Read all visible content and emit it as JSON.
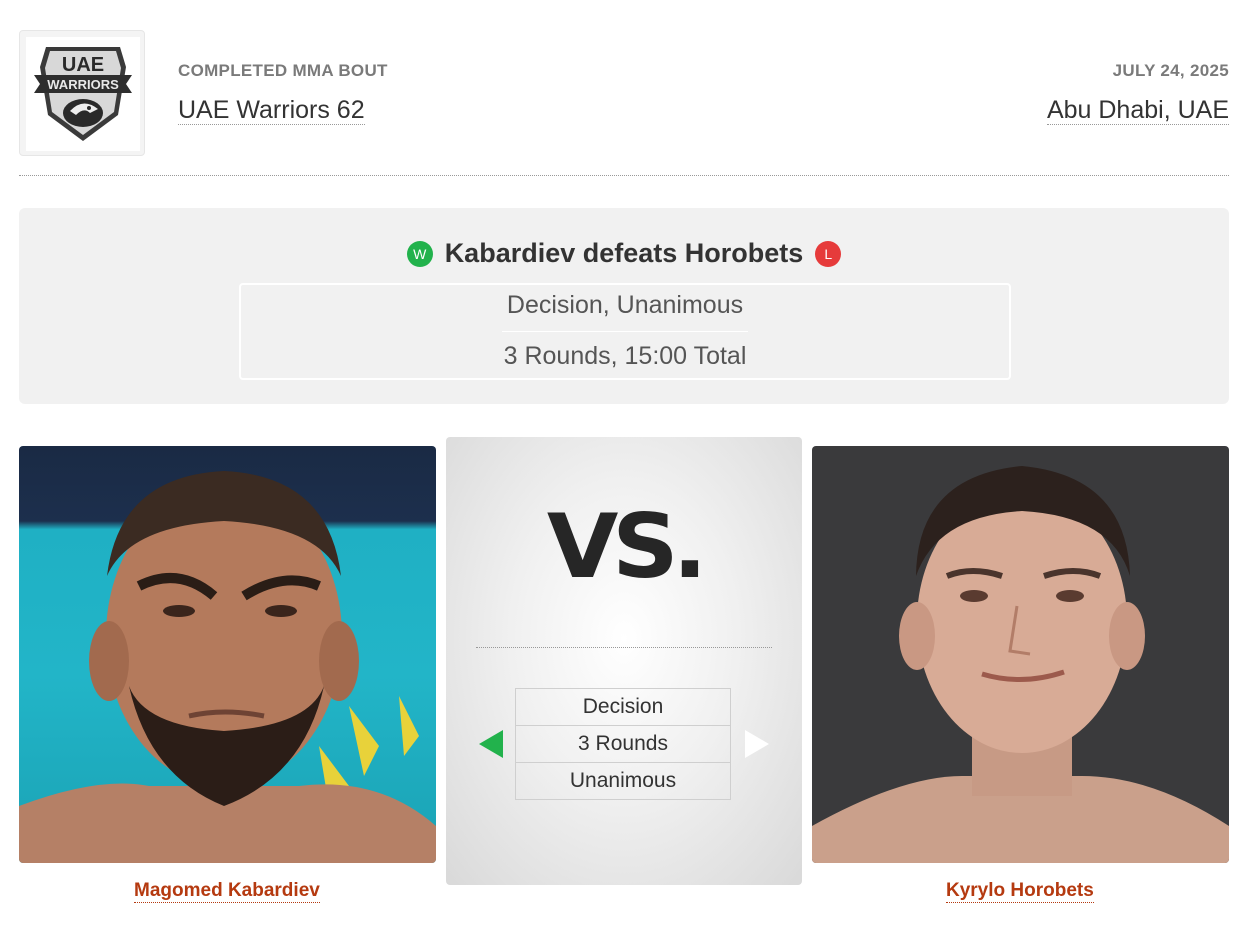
{
  "event": {
    "type": "COMPLETED MMA BOUT",
    "name": "UAE Warriors 62",
    "date": "JULY 24, 2025",
    "location": "Abu Dhabi, UAE",
    "logo_text_top": "UAE",
    "logo_text_banner": "WARRIORS"
  },
  "result": {
    "winner_badge": "W",
    "loser_badge": "L",
    "headline": "Kabardiev defeats Horobets",
    "method": "Decision, Unanimous",
    "duration": "3 Rounds, 15:00 Total"
  },
  "versus": {
    "vs_text": "VS.",
    "rows": [
      "Decision",
      "3 Rounds",
      "Unanimous"
    ],
    "winner_arrow_color": "#22b24c"
  },
  "fighters": {
    "left": {
      "name": "Magomed Kabardiev"
    },
    "right": {
      "name": "Kyrylo Horobets"
    }
  },
  "colors": {
    "win": "#22b24c",
    "loss": "#e63b3b",
    "fighter_link": "#b53a10"
  }
}
